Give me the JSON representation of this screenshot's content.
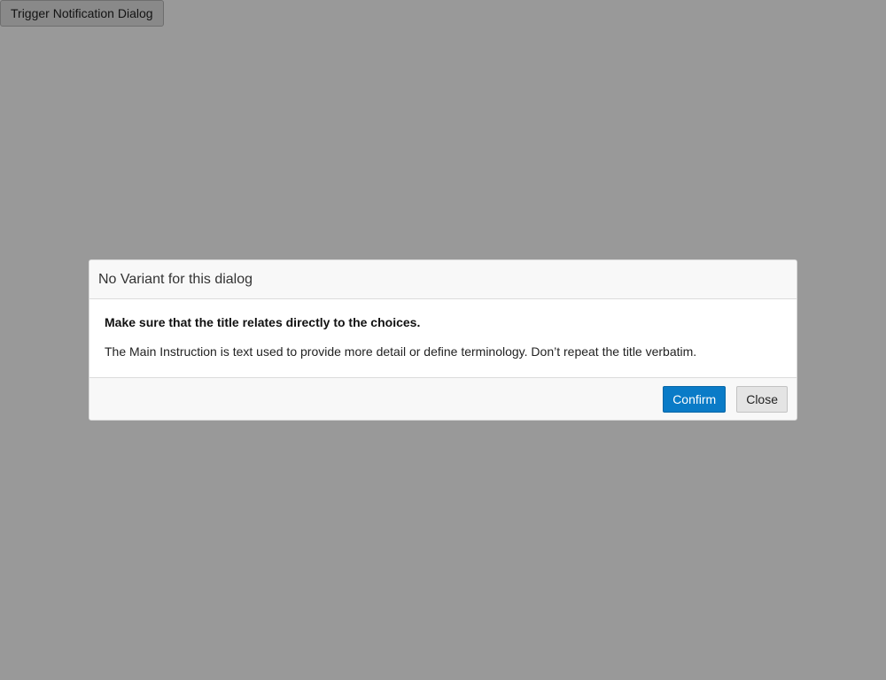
{
  "page": {
    "trigger_label": "Trigger Notification Dialog"
  },
  "dialog": {
    "title": "No Variant for this dialog",
    "main_instruction": "Make sure that the title relates directly to the choices.",
    "description": "The Main Instruction is text used to provide more detail or define terminology. Don’t repeat the title verbatim.",
    "confirm_label": "Confirm",
    "close_label": "Close"
  },
  "colors": {
    "overlay": "#999999",
    "primary_button": "#0a7bc7",
    "secondary_button": "#e4e4e4"
  }
}
